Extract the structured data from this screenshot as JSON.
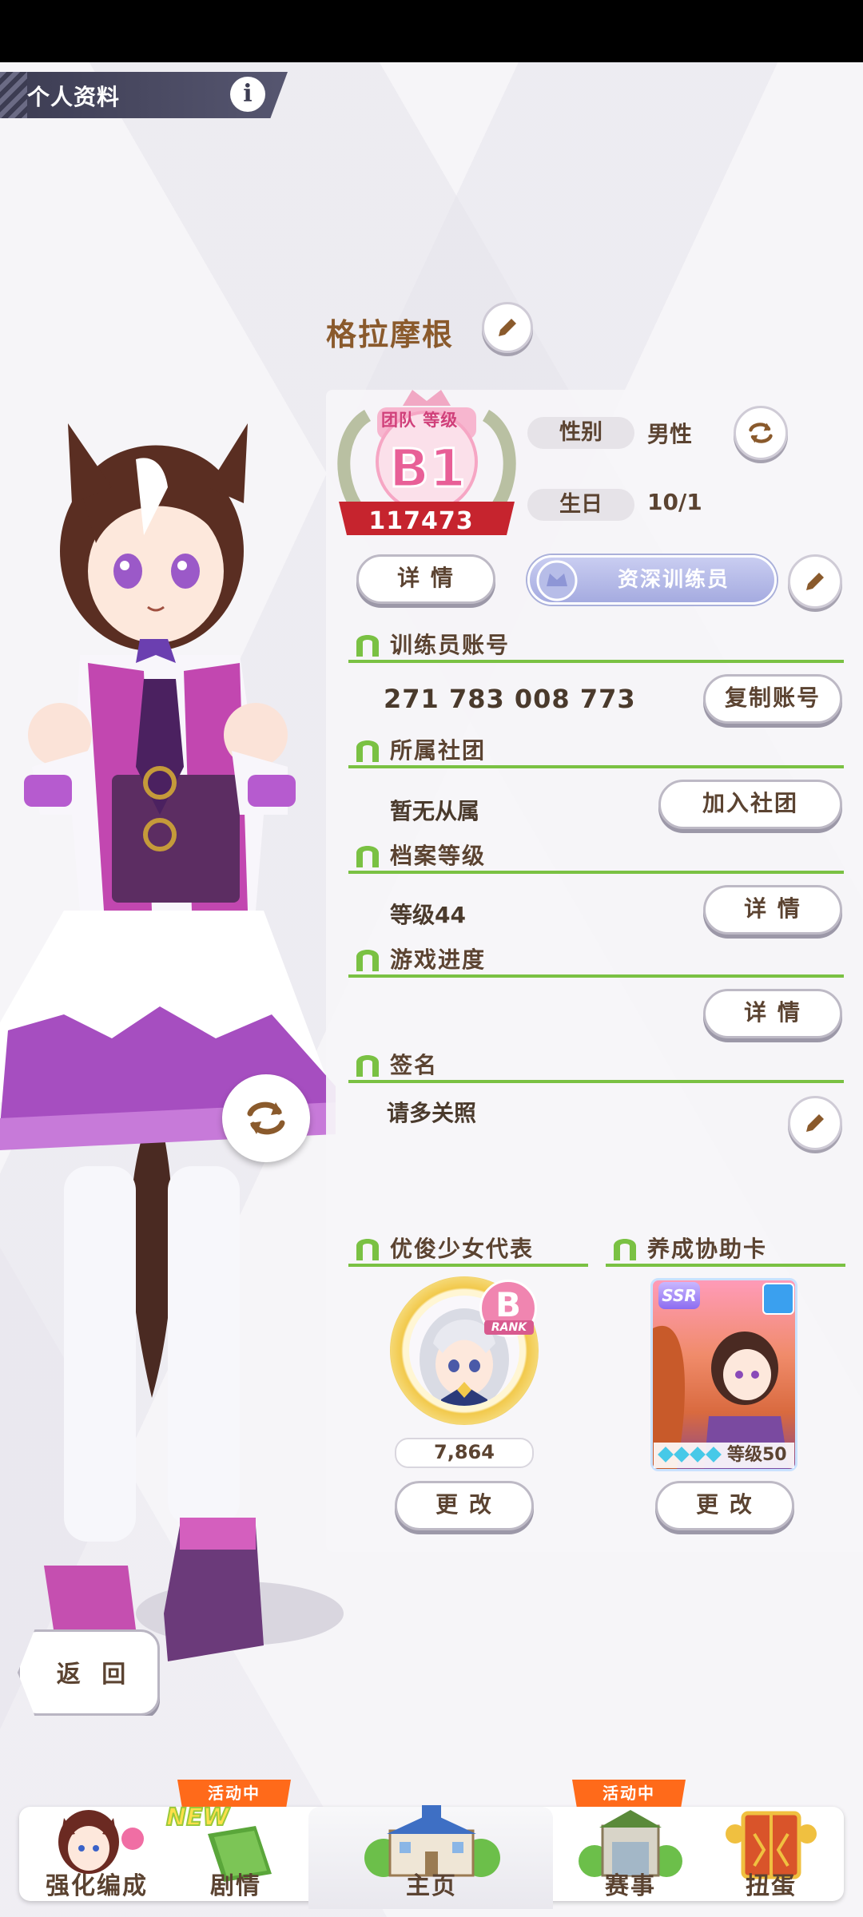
{
  "header": {
    "title": "个人资料",
    "info_icon": "i"
  },
  "profile": {
    "name": "格拉摩根",
    "rank": {
      "team_label": "团队 等级",
      "grade": "B1",
      "points": "117473"
    },
    "gender_label": "性别",
    "gender_value": "男性",
    "birthday_label": "生日",
    "birthday_value": "10/1",
    "details_label": "详 情",
    "trainer_title": "资深训练员"
  },
  "sections": {
    "account": {
      "title": "训练员账号",
      "value": "271 783 008 773",
      "button": "复制账号"
    },
    "club": {
      "title": "所属社团",
      "value": "暂无从属",
      "button": "加入社团"
    },
    "profile_level": {
      "title": "档案等级",
      "value": "等级44",
      "button": "详 情"
    },
    "progress": {
      "title": "游戏进度",
      "button": "详 情"
    },
    "signature": {
      "title": "签名",
      "value": "请多关照"
    },
    "representative": {
      "title": "优俊少女代表",
      "rank_letter": "B",
      "rank_sub": "RANK",
      "score": "7,864",
      "button": "更 改"
    },
    "support_card": {
      "title": "养成协助卡",
      "rarity": "SSR",
      "level": "等级50",
      "button": "更 改"
    }
  },
  "back_button": "返 回",
  "nav": {
    "items": [
      {
        "label": "强化编成"
      },
      {
        "label": "剧情",
        "tag": "活动中",
        "badge": "NEW"
      },
      {
        "label": "主页"
      },
      {
        "label": "赛事",
        "tag": "活动中"
      },
      {
        "label": "扭蛋"
      }
    ]
  },
  "colors": {
    "accent_green": "#7ac143",
    "text_brown": "#5b4331",
    "name_brown": "#8a5a2c",
    "rank_pink": "#e85f97",
    "event_orange": "#ff6a1a"
  }
}
